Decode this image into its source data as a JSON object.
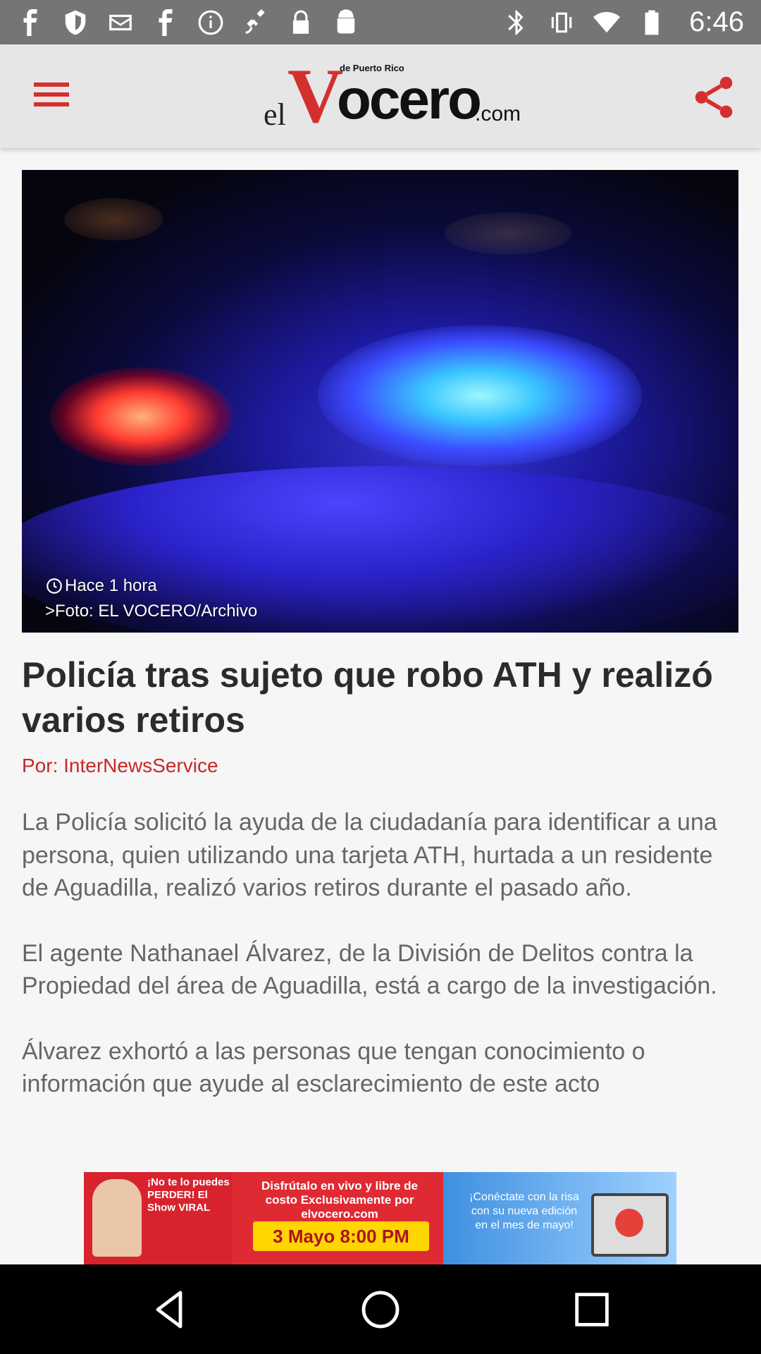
{
  "status_bar": {
    "time": "6:46",
    "left_icons": [
      "facebook-icon",
      "shield-icon",
      "mail-icon",
      "facebook-icon",
      "info-icon",
      "satellite-icon",
      "lock-icon",
      "android-icon"
    ],
    "right_icons": [
      "bluetooth-icon",
      "vibrate-icon",
      "wifi-icon",
      "battery-icon"
    ]
  },
  "app_bar": {
    "logo": {
      "prefix": "el",
      "v": "V",
      "main": "ocero",
      "suffix": ".com",
      "tagline": "de Puerto Rico"
    },
    "accent_color": "#d32f2f"
  },
  "hero": {
    "time_ago": "Hace 1 hora",
    "credit": ">Foto: EL VOCERO/Archivo"
  },
  "article": {
    "title": "Policía tras sujeto que robo ATH y realizó varios retiros",
    "byline": "Por: InterNewsService",
    "paragraphs": [
      "La Policía solicitó la ayuda de la ciudadanía para identificar a una persona, quien utilizando una tarjeta ATH, hurtada a un residente de Aguadilla, realizó varios retiros durante el pasado año.",
      "El agente Nathanael Álvarez, de la División de Delitos contra la Propiedad del área de Aguadilla, está a cargo de la investigación.",
      "Álvarez exhortó a las personas que tengan conocimiento o información que ayude al esclarecimiento de este acto"
    ]
  },
  "ad": {
    "left_text": "¡No te lo puedes PERDER! El Show VIRAL",
    "mid_text": "Disfrútalo en vivo y libre de costo Exclusivamente por elvocero.com",
    "date": "3 Mayo 8:00 PM",
    "right_text": "¡Conéctate con la risa con su nueva edición en el mes de mayo!"
  },
  "nav": {
    "buttons": [
      "back-icon",
      "home-icon",
      "recents-icon"
    ]
  }
}
